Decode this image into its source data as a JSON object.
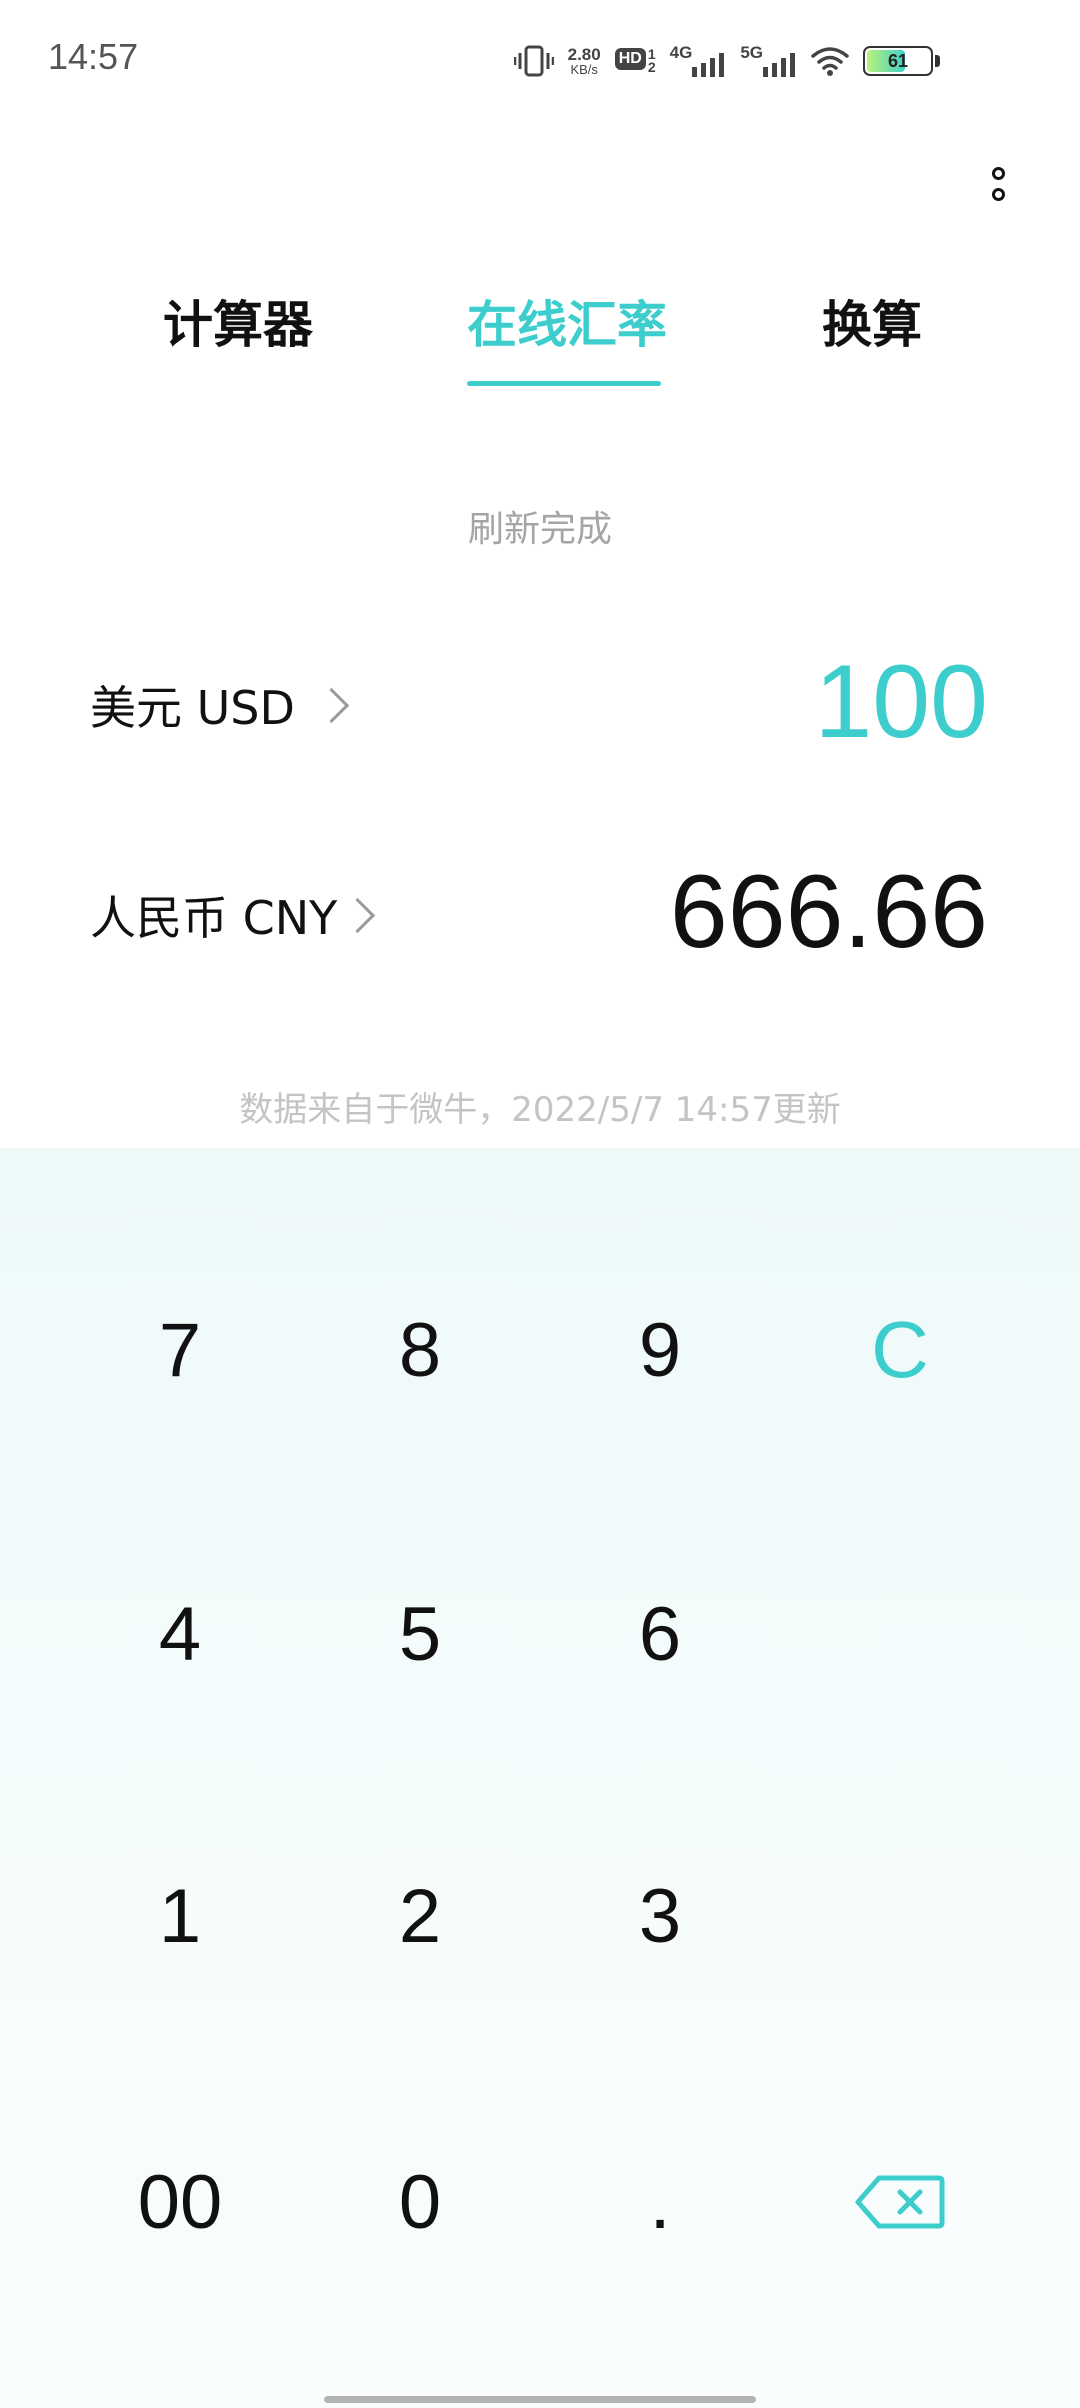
{
  "status_bar": {
    "time": "14:57",
    "net_speed_value": "2.80",
    "net_speed_unit": "KB/s",
    "hd_label": "HD",
    "sim1": "1",
    "sim2": "2",
    "network_4g": "4G",
    "network_5g": "5G",
    "battery_level": "61"
  },
  "tabs": [
    {
      "label": "计算器",
      "active": false
    },
    {
      "label": "在线汇率",
      "active": true
    },
    {
      "label": "换算",
      "active": false
    }
  ],
  "refresh_status": "刷新完成",
  "from_currency": {
    "label": "美元 USD",
    "amount": "100"
  },
  "to_currency": {
    "label": "人民币 CNY",
    "amount": "666.66"
  },
  "data_source": "数据来自于微牛，2022/5/7 14:57更新",
  "keypad": {
    "row1": [
      "7",
      "8",
      "9",
      "C"
    ],
    "row2": [
      "4",
      "5",
      "6"
    ],
    "row3": [
      "1",
      "2",
      "3"
    ],
    "row4": [
      "00",
      "0",
      "."
    ]
  },
  "colors": {
    "accent": "#3dcdcd"
  }
}
